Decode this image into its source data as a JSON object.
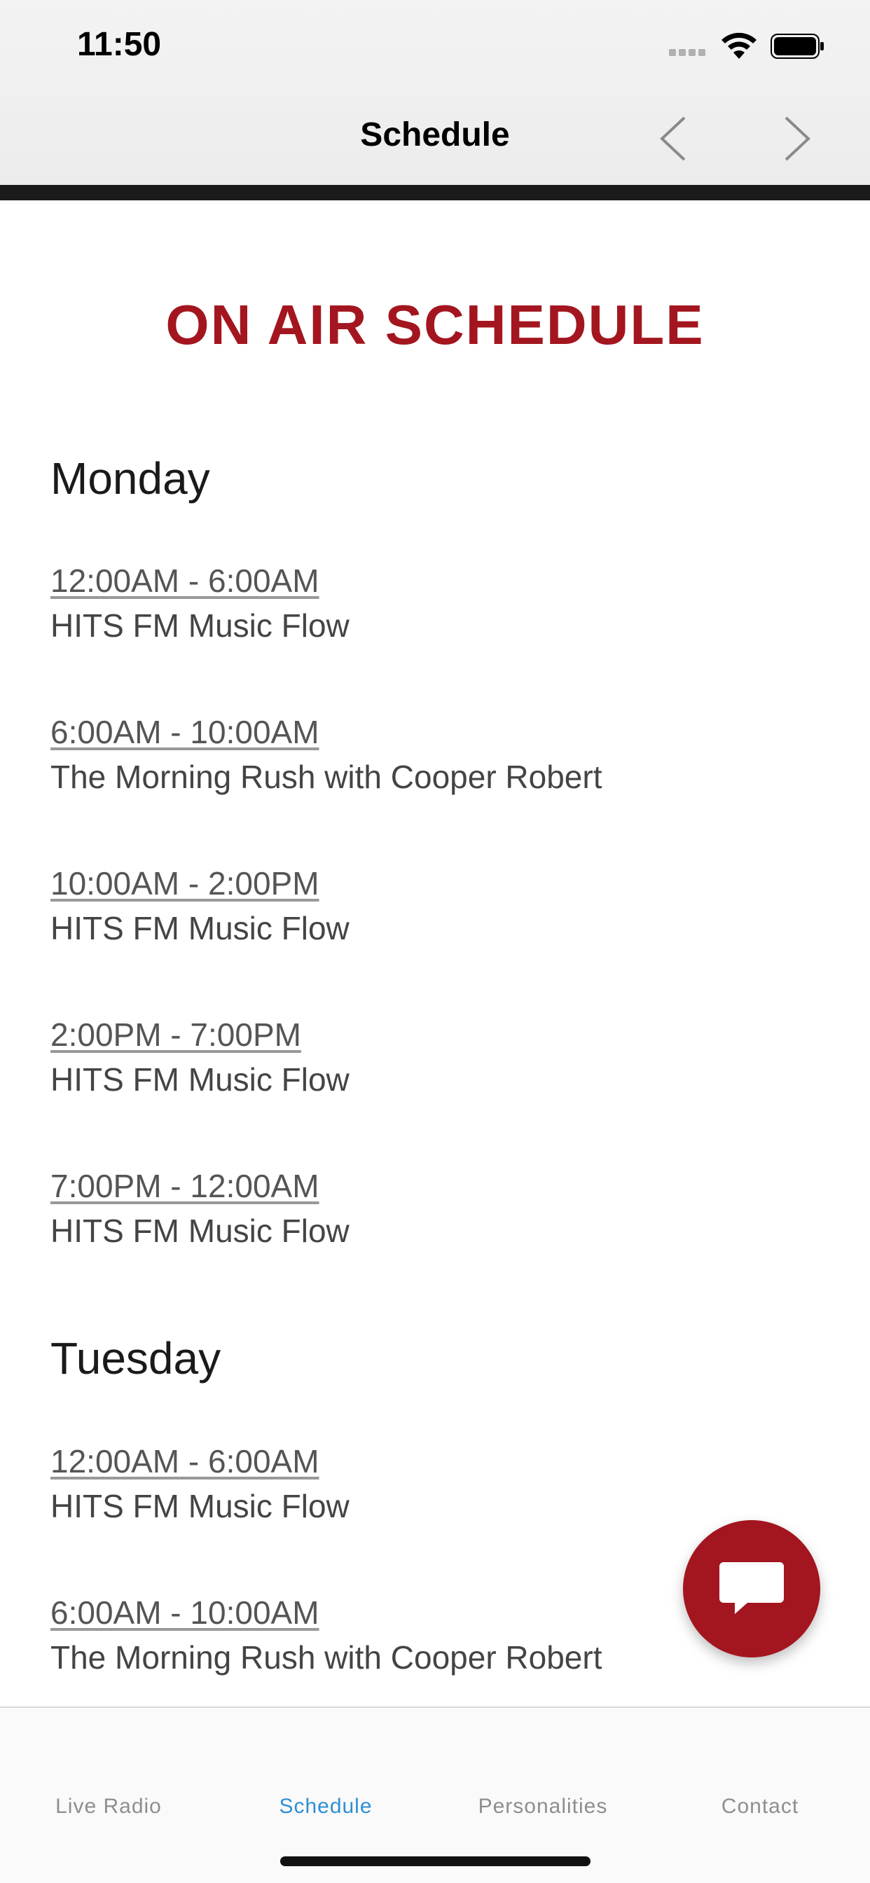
{
  "status_bar": {
    "time": "11:50"
  },
  "header": {
    "title": "Schedule"
  },
  "page_heading": "ON AIR SCHEDULE",
  "days": [
    {
      "name": "Monday",
      "slots": [
        {
          "time": "12:00AM - 6:00AM",
          "show": "HITS FM Music Flow"
        },
        {
          "time": "6:00AM - 10:00AM",
          "show": "The Morning Rush with Cooper Robert"
        },
        {
          "time": "10:00AM - 2:00PM",
          "show": "HITS FM Music Flow"
        },
        {
          "time": "2:00PM - 7:00PM",
          "show": "HITS FM Music Flow"
        },
        {
          "time": "7:00PM - 12:00AM",
          "show": "HITS FM Music Flow"
        }
      ]
    },
    {
      "name": "Tuesday",
      "slots": [
        {
          "time": "12:00AM - 6:00AM",
          "show": "HITS FM Music Flow"
        },
        {
          "time": "6:00AM - 10:00AM",
          "show": "The Morning Rush with Cooper Robert"
        }
      ]
    }
  ],
  "tabs": [
    {
      "label": "Live Radio",
      "active": false
    },
    {
      "label": "Schedule",
      "active": true
    },
    {
      "label": "Personalities",
      "active": false
    },
    {
      "label": "Contact",
      "active": false
    }
  ],
  "colors": {
    "accent": "#a3161f",
    "tab_active": "#2f8fd3",
    "header_bar": "#1b1b1b"
  },
  "icons": {
    "chat": "chat-bubble-icon",
    "back": "chevron-left-icon",
    "forward": "chevron-right-icon"
  }
}
